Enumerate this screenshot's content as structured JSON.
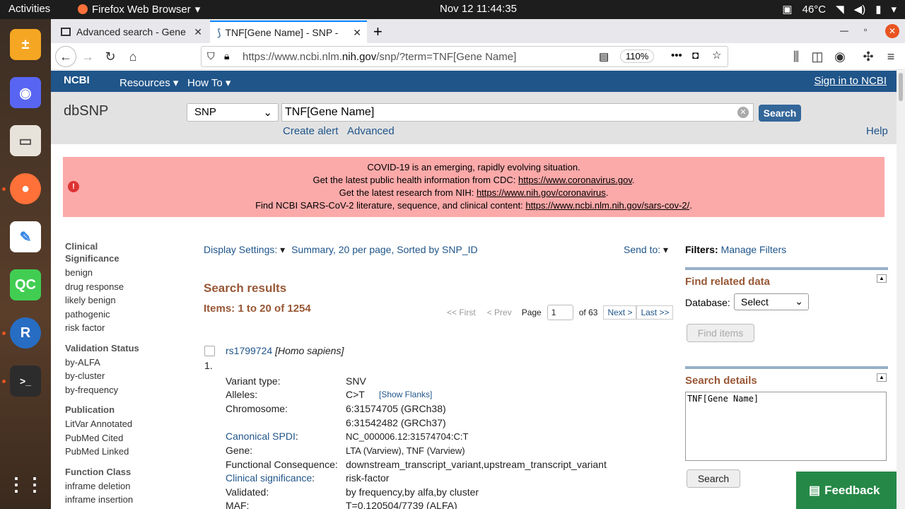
{
  "topbar": {
    "activities": "Activities",
    "app_name": "Firefox Web Browser",
    "clock": "Nov 12  11:44:35",
    "temp": "46°C"
  },
  "tabs": [
    {
      "title": "Advanced search - Gene"
    },
    {
      "title": "TNF[Gene Name] - SNP -"
    }
  ],
  "navbar": {
    "url_prefix": "https://www.ncbi.nlm.",
    "url_domain": "nih.gov",
    "url_suffix": "/snp/?term=TNF[Gene Name]",
    "zoom": "110%"
  },
  "ncbi": {
    "logo": "NCBI",
    "resources": "Resources",
    "howto": "How To",
    "signin": "Sign in to NCBI"
  },
  "search": {
    "db_title": "dbSNP",
    "db_selected": "SNP",
    "term": "TNF[Gene Name]",
    "button": "Search",
    "create_alert": "Create alert",
    "advanced": "Advanced",
    "help": "Help"
  },
  "covid": {
    "line1": "COVID-19 is an emerging, rapidly evolving situation.",
    "line2": "Get the latest public health information from CDC: ",
    "link2": "https://www.coronavirus.gov",
    "line3": "Get the latest research from NIH: ",
    "link3": "https://www.nih.gov/coronavirus",
    "line4": "Find NCBI SARS-CoV-2 literature, sequence, and clinical content: ",
    "link4": "https://www.ncbi.nlm.nih.gov/sars-cov-2/"
  },
  "sidebar": [
    {
      "heading": "Clinical Significance",
      "items": [
        "benign",
        "drug response",
        "likely benign",
        "pathogenic",
        "risk factor"
      ]
    },
    {
      "heading": "Validation Status",
      "items": [
        "by-ALFA",
        "by-cluster",
        "by-frequency"
      ]
    },
    {
      "heading": "Publication",
      "items": [
        "LitVar Annotated",
        "PubMed Cited",
        "PubMed Linked"
      ]
    },
    {
      "heading": "Function Class",
      "items": [
        "inframe deletion",
        "inframe insertion"
      ]
    }
  ],
  "display": {
    "settings": "Display Settings:",
    "summary": "Summary, 20 per page, Sorted by SNP_ID",
    "sendto": "Send to:"
  },
  "results": {
    "title": "Search results",
    "items": "Items: 1 to 20 of 1254",
    "first": "<< First",
    "prev": "< Prev",
    "page_label": "Page",
    "page": "1",
    "of": "of 63",
    "next": "Next >",
    "last": "Last >>"
  },
  "record": {
    "id": "rs1799724",
    "species": "[Homo sapiens]",
    "num": "1.",
    "rows": [
      {
        "label": "Variant type:",
        "value": "SNV"
      },
      {
        "label": "Alleles:",
        "value": "C>T",
        "extra": "[Show Flanks]"
      },
      {
        "label": "Chromosome:",
        "value": "6:31574705 (GRCh38)",
        "value2": "6:31542482 (GRCh37)"
      },
      {
        "label": "Canonical SPDI",
        "value": "NC_000006.12:31574704:C:T"
      },
      {
        "label": "Gene:",
        "value": "LTA (Varview), TNF (Varview)"
      },
      {
        "label": "Functional Consequence:",
        "value": "downstream_transcript_variant,upstream_transcript_variant"
      },
      {
        "label": "Clinical significance",
        "value": "risk-factor"
      },
      {
        "label": "Validated:",
        "value": "by frequency,by alfa,by cluster"
      },
      {
        "label": "MAF:",
        "value": "T=0.120504/7739 (ALFA)"
      }
    ]
  },
  "right": {
    "filters": "Filters:",
    "manage": "Manage Filters",
    "find_related": "Find related data",
    "database": "Database:",
    "db_select": "Select",
    "find_items": "Find items",
    "search_details": "Search details",
    "details_text": "TNF[Gene Name]",
    "search_btn": "Search"
  },
  "feedback": "Feedback"
}
